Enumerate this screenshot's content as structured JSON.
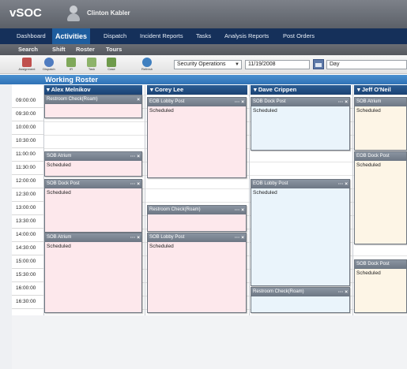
{
  "app": {
    "title": "vSOC",
    "user_name": "Clinton Kabler"
  },
  "nav": {
    "items": [
      "Dashboard",
      "Activities",
      "Dispatch",
      "Incident Reports",
      "Tasks",
      "Analysis Reports",
      "Post Orders"
    ],
    "active": "Activities"
  },
  "subnav": {
    "items": [
      "Search",
      "Shift",
      "Roster",
      "Tours"
    ]
  },
  "toolbar": {
    "tools": [
      "Assignment",
      "Dispatch",
      "IR",
      "Task",
      "Case",
      "Refresh"
    ],
    "team": "Security Operations",
    "date": "11/19/2008",
    "view": "Day"
  },
  "roster": {
    "title": "Working Roster"
  },
  "times": [
    "09:00:00",
    "09:30:00",
    "10:00:00",
    "10:30:00",
    "11:00:00",
    "11:30:00",
    "12:00:00",
    "12:30:00",
    "13:00:00",
    "13:30:00",
    "14:00:00",
    "14:30:00",
    "15:00:00",
    "15:30:00",
    "16:00:00",
    "16:30:00"
  ],
  "columns": [
    {
      "name": "Alex Melnikov",
      "blocks": [
        {
          "title": "Restroom Check(Roam)",
          "ctl": "×",
          "body": ""
        },
        {
          "title": "SOB Atrium",
          "ctl": "··· ×",
          "body": "Scheduled"
        },
        {
          "title": "SOB Dock Post",
          "ctl": "··· ×",
          "body": "Scheduled"
        },
        {
          "title": "SOB Atrium",
          "ctl": "··· ×",
          "body": "Scheduled"
        }
      ]
    },
    {
      "name": "Corey Lee",
      "blocks": [
        {
          "title": "EOB Lobby Post",
          "ctl": "··· ×",
          "body": "Scheduled"
        },
        {
          "title": "Restroom Check(Roam)",
          "ctl": "··· ×",
          "body": ""
        },
        {
          "title": "SOB Lobby Post",
          "ctl": "··· ×",
          "body": "Scheduled"
        }
      ]
    },
    {
      "name": "Dave Crippen",
      "blocks": [
        {
          "title": "SOB Dock Post",
          "ctl": "··· ×",
          "body": "Scheduled"
        },
        {
          "title": "EOB Lobby Post",
          "ctl": "··· ×",
          "body": "Scheduled"
        },
        {
          "title": "Restroom Check(Roam)",
          "ctl": "··· ×",
          "body": ""
        }
      ]
    },
    {
      "name": "Jeff O'Neil",
      "blocks": [
        {
          "title": "SOB Atrium",
          "ctl": "",
          "body": "Scheduled"
        },
        {
          "title": "EOB Dock Post",
          "ctl": "",
          "body": "Scheduled"
        },
        {
          "title": "SOB Dock Post",
          "ctl": "",
          "body": "Scheduled"
        }
      ]
    }
  ],
  "colors": {
    "nav_bg": "#15305a",
    "nav_active": "#1e5d9e",
    "roster_bar": "#2f72b6",
    "block_header": "#6d7784",
    "pink": "#fde8ec",
    "blue": "#eaf4fb",
    "cream": "#fdf5e6"
  },
  "icons": [
    "user-avatar-icon",
    "assignment-icon",
    "dispatch-icon",
    "ir-icon",
    "task-icon",
    "case-icon",
    "refresh-icon",
    "calendar-icon",
    "dropdown-arrow-icon",
    "close-icon",
    "more-icon"
  ]
}
